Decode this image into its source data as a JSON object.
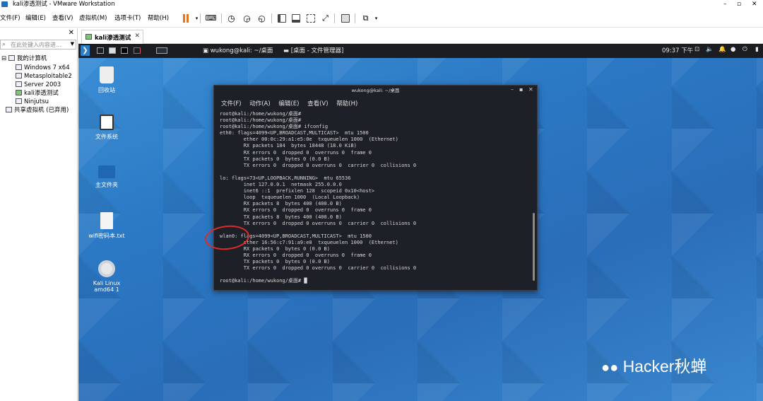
{
  "window": {
    "title": "kali渗透测试 - VMware Workstation"
  },
  "menubar": {
    "items": [
      "文件(F)",
      "编辑(E)",
      "查看(V)",
      "虚拟机(M)",
      "选项卡(T)",
      "帮助(H)"
    ]
  },
  "library": {
    "search_placeholder": "在此处键入内容进...",
    "tree": [
      "我的计算机",
      "Windows 7 x64",
      "Metasploitable2",
      "Server 2003",
      "kali渗透测试",
      "Ninjutsu",
      "共享虚拟机 (已弃用)"
    ]
  },
  "tab": {
    "label": "kali渗透测试"
  },
  "guest": {
    "panel": {
      "window1": "wukong@kali: ~/桌面",
      "window2": "[桌面 - 文件管理器]",
      "clock": "09:37 下午"
    },
    "desktop_icons": [
      "回收站",
      "文件系统",
      "主文件夹",
      "wifi密码本.txt",
      "Kali Linux amd64 1"
    ],
    "terminal": {
      "title": "wukong@kali: ~/桌面",
      "menu": [
        "文件(F)",
        "动作(A)",
        "编辑(E)",
        "查看(V)",
        "帮助(H)"
      ],
      "output": "root@kali:/home/wukong/桌面#\nroot@kali:/home/wukong/桌面#\nroot@kali:/home/wukong/桌面# ifconfig\neth0: flags=4099<UP,BROADCAST,MULTICAST>  mtu 1500\n        ether 00:0c:29:a1:e5:0e  txqueuelen 1000  (Ethernet)\n        RX packets 184  bytes 18448 (18.0 KiB)\n        RX errors 0  dropped 0  overruns 0  frame 0\n        TX packets 0  bytes 0 (0.0 B)\n        TX errors 0  dropped 0 overruns 0  carrier 0  collisions 0\n\nlo: flags=73<UP,LOOPBACK,RUNNING>  mtu 65536\n        inet 127.0.0.1  netmask 255.0.0.0\n        inet6 ::1  prefixlen 128  scopeid 0x10<host>\n        loop  txqueuelen 1000  (Local Loopback)\n        RX packets 8  bytes 400 (400.0 B)\n        RX errors 0  dropped 0  overruns 0  frame 0\n        TX packets 8  bytes 400 (400.0 B)\n        TX errors 0  dropped 0 overruns 0  carrier 0  collisions 0\n\nwlan0: flags=4099<UP,BROADCAST,MULTICAST>  mtu 1500\n        ether 16:56:c7:91:a9:e0  txqueuelen 1000  (Ethernet)\n        RX packets 0  bytes 0 (0.0 B)\n        RX errors 0  dropped 0  overruns 0  frame 0\n        TX packets 0  bytes 0 (0.0 B)\n        TX errors 0  dropped 0 overruns 0  carrier 0  collisions 0\n\nroot@kali:/home/wukong/桌面# █"
    }
  },
  "watermark": "Hacker秋蝉",
  "colors": {
    "highlight_circle": "#e02a2a",
    "pause": "#e8731c"
  }
}
